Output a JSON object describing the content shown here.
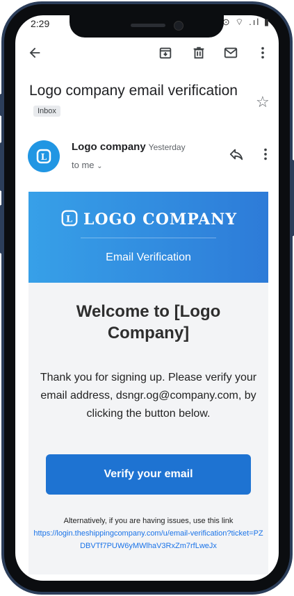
{
  "status": {
    "time": "2:29",
    "icons": "⊙ ⌔ .ıl ▮"
  },
  "toolbar": {
    "back": "back-arrow-icon",
    "archive": "archive-icon",
    "delete": "delete-icon",
    "mark_unread": "mail-icon",
    "more": "more-vert-icon"
  },
  "email": {
    "subject": "Logo company email verification",
    "badge": "Inbox",
    "sender": "Logo company",
    "date": "Yesterday",
    "to": "to me",
    "banner_title": "LOGO COMPANY",
    "banner_subtitle": "Email Verification",
    "welcome": "Welcome to [Logo Company]",
    "body": "Thank you for signing up. Please verify your email address, dsngr.og@company.com, by clicking the button below.",
    "button": "Verify your email",
    "alt_text": "Alternatively, if you are having issues, use this link",
    "alt_link": "https://login.theshippingcompany.com/u/email-verification?ticket=PZDBVTf7PUW6yMWlhaV3RxZm7rfLweJx"
  },
  "colors": {
    "frame": "#2c3e5a",
    "accent": "#1e73d2",
    "banner_start": "#37a0e8",
    "banner_end": "#2d7bd8"
  }
}
